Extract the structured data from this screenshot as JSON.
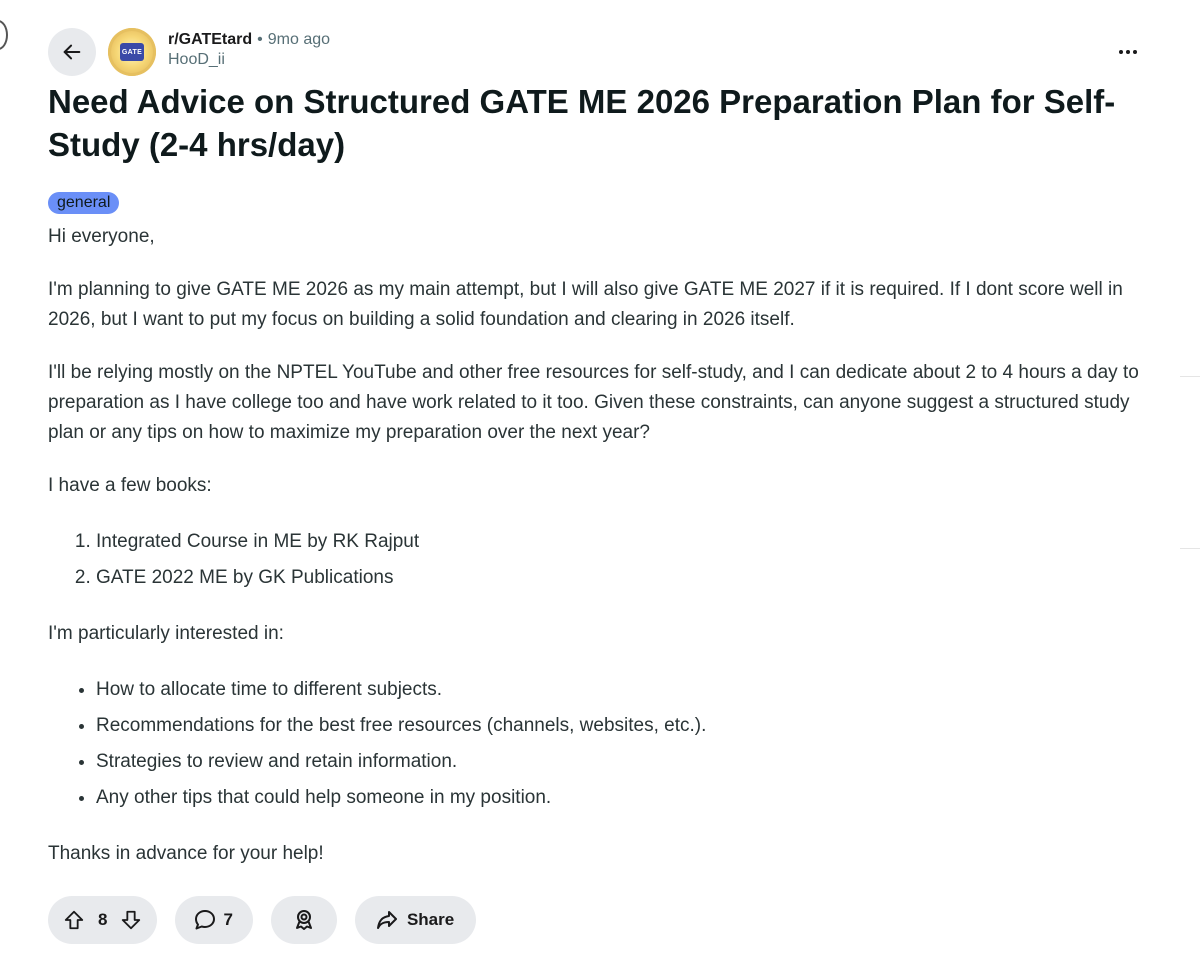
{
  "post": {
    "subreddit": "r/GATEtard",
    "separator": "•",
    "time_ago": "9mo ago",
    "author": "HooD_ii",
    "avatar_text": "GATE",
    "title": "Need Advice on Structured GATE ME 2026 Preparation Plan for Self-Study (2-4 hrs/day)",
    "flair": "general",
    "body": {
      "greeting": "Hi everyone,",
      "para1": "I'm planning to give GATE ME 2026 as my main attempt, but I will also give GATE ME 2027 if it is required. If I dont score well in 2026, but I want to put my focus on building a solid foundation and clearing in 2026 itself.",
      "para2": "I'll be relying mostly on the NPTEL YouTube and other free resources for self-study, and I can dedicate about 2 to 4 hours a day to preparation as I have college too and have work related to it too. Given these constraints, can anyone suggest a structured study plan or any tips on how to maximize my preparation over the next year?",
      "books_intro": "I have a few books:",
      "books": [
        "Integrated Course in ME by RK Rajput",
        "GATE 2022 ME by GK Publications"
      ],
      "interests_intro": "I'm particularly interested in:",
      "interests": [
        "How to allocate time to different subjects.",
        "Recommendations for the best free resources (channels, websites, etc.).",
        "Strategies to review and retain information.",
        "Any other tips that could help someone in my position."
      ],
      "closing": "Thanks in advance for your help!"
    }
  },
  "actions": {
    "vote_count": "8",
    "comment_count": "7",
    "share_label": "Share"
  },
  "icons": {
    "back": "arrow-left-icon",
    "more": "more-horizontal-icon",
    "upvote": "arrow-up-icon",
    "downvote": "arrow-down-icon",
    "comment": "comment-bubble-icon",
    "award": "award-icon",
    "share": "share-arrow-icon"
  },
  "colors": {
    "flair_bg": "#6a8ff7",
    "pill_bg": "#e8eaed",
    "meta_gray": "#576f76"
  }
}
